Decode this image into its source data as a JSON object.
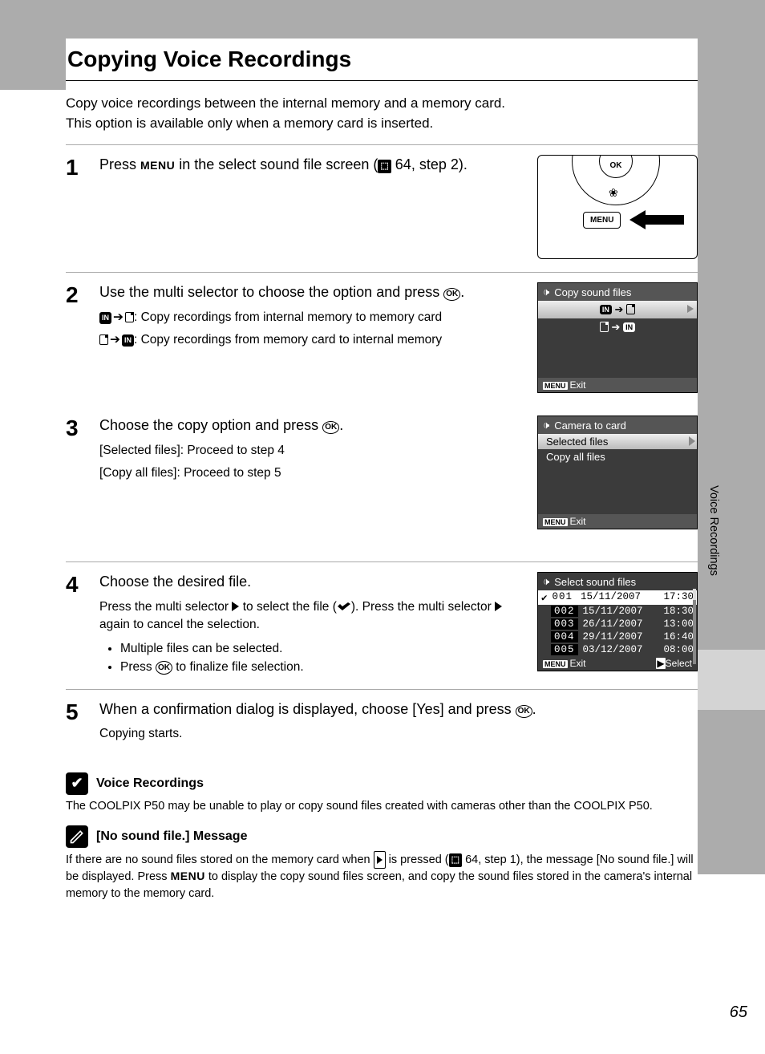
{
  "page_number": "65",
  "side_section": "Voice Recordings",
  "title": "Copying Voice Recordings",
  "intro_line1": "Copy voice recordings between the internal memory and a memory card.",
  "intro_line2": "This option is available only when a memory card is inserted.",
  "steps": {
    "s1": {
      "num": "1",
      "head_a": "Press ",
      "head_menu": "MENU",
      "head_b": " in the select sound file screen (",
      "head_ref": " 64, step 2).",
      "diag_ok": "OK",
      "diag_menu": "MENU"
    },
    "s2": {
      "num": "2",
      "head": "Use the multi selector to choose the option and press ",
      "ok": "OK",
      "head_end": ".",
      "sub_a": ": Copy recordings from internal memory to memory card",
      "sub_b": ": Copy recordings from memory card to internal memory",
      "lcd_title": "Copy sound files",
      "lcd_exit": "Exit",
      "menu_chip": "MENU",
      "in_chip": "IN"
    },
    "s3": {
      "num": "3",
      "head": "Choose the copy option and press ",
      "ok": "OK",
      "head_end": ".",
      "sub1": "[Selected files]: Proceed to step 4",
      "sub2": "[Copy all files]: Proceed to step 5",
      "lcd_title": "Camera to card",
      "lcd_opt1": "Selected files",
      "lcd_opt2": "Copy all files",
      "lcd_exit": "Exit",
      "menu_chip": "MENU"
    },
    "s4": {
      "num": "4",
      "head": "Choose the desired file.",
      "sub_a1": "Press the multi selector ",
      "sub_a2": " to select the file (",
      "sub_a3": "). Press the multi selector ",
      "sub_a4": " again to cancel the selection.",
      "b1": "Multiple files can be selected.",
      "b2a": "Press ",
      "b2b": " to finalize file selection.",
      "ok": "OK",
      "lcd_title": "Select sound files",
      "files": [
        {
          "n": "001",
          "d": "15/11/2007",
          "t": "17:30",
          "sel": true
        },
        {
          "n": "002",
          "d": "15/11/2007",
          "t": "18:30",
          "sel": false
        },
        {
          "n": "003",
          "d": "26/11/2007",
          "t": "13:00",
          "sel": false
        },
        {
          "n": "004",
          "d": "29/11/2007",
          "t": "16:40",
          "sel": false
        },
        {
          "n": "005",
          "d": "03/12/2007",
          "t": "08:00",
          "sel": false
        }
      ],
      "lcd_exit": "Exit",
      "lcd_select": "Select",
      "menu_chip": "MENU"
    },
    "s5": {
      "num": "5",
      "head": "When a confirmation dialog is displayed, choose [Yes] and press ",
      "ok": "OK",
      "head_end": ".",
      "sub": "Copying starts."
    }
  },
  "note1": {
    "title": "Voice Recordings",
    "body": "The COOLPIX P50 may be unable to play or copy sound files created with cameras other than the COOLPIX P50."
  },
  "note2": {
    "title": "[No sound file.] Message",
    "body_a": "If there are no sound files stored on the memory card when ",
    "body_b": " is pressed (",
    "body_ref": " 64, step 1), the message [No sound file.] will be displayed. Press ",
    "body_menu": "MENU",
    "body_c": " to display the copy sound files screen, and copy the sound files stored in the camera's internal memory to the memory card."
  }
}
